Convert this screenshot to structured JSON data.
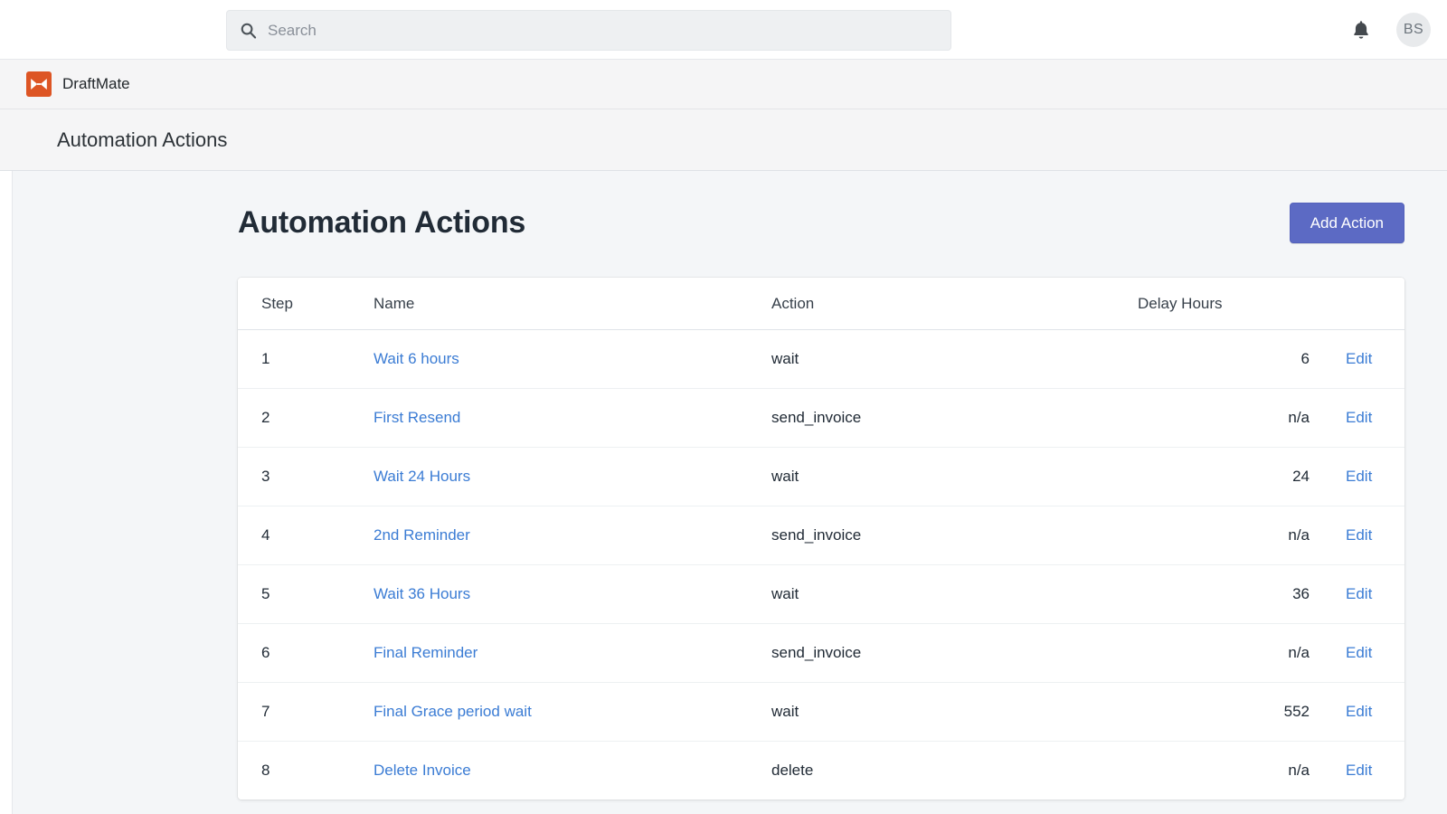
{
  "topbar": {
    "search": {
      "placeholder": "Search",
      "value": "",
      "icon": "search-icon"
    },
    "notifications_icon": "bell-icon",
    "avatar_initials": "BS"
  },
  "brand": {
    "name": "DraftMate",
    "logo_icon": "draftmate-logo-icon",
    "logo_color": "#dd5524"
  },
  "section_header": {
    "title": "Automation Actions"
  },
  "page": {
    "title": "Automation Actions",
    "add_button_label": "Add Action",
    "add_button_color": "#5c6ac4",
    "link_color": "#3b7cd4"
  },
  "table": {
    "columns": [
      "Step",
      "Name",
      "Action",
      "Delay Hours",
      ""
    ],
    "edit_label": "Edit",
    "rows": [
      {
        "step": "1",
        "name": "Wait 6 hours",
        "action": "wait",
        "delay_hours": "6",
        "edit": "Edit"
      },
      {
        "step": "2",
        "name": "First Resend",
        "action": "send_invoice",
        "delay_hours": "n/a",
        "edit": "Edit"
      },
      {
        "step": "3",
        "name": "Wait 24 Hours",
        "action": "wait",
        "delay_hours": "24",
        "edit": "Edit"
      },
      {
        "step": "4",
        "name": "2nd Reminder",
        "action": "send_invoice",
        "delay_hours": "n/a",
        "edit": "Edit"
      },
      {
        "step": "5",
        "name": "Wait 36 Hours",
        "action": "wait",
        "delay_hours": "36",
        "edit": "Edit"
      },
      {
        "step": "6",
        "name": "Final Reminder",
        "action": "send_invoice",
        "delay_hours": "n/a",
        "edit": "Edit"
      },
      {
        "step": "7",
        "name": "Final Grace period wait",
        "action": "wait",
        "delay_hours": "552",
        "edit": "Edit"
      },
      {
        "step": "8",
        "name": "Delete Invoice",
        "action": "delete",
        "delay_hours": "n/a",
        "edit": "Edit"
      }
    ]
  }
}
